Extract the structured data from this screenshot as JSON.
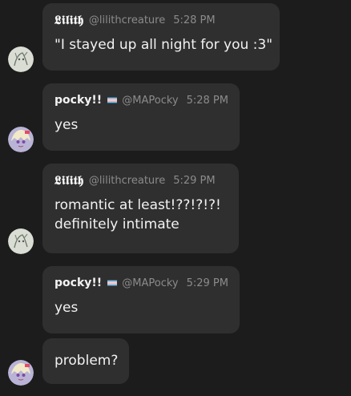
{
  "messages": [
    {
      "author": "𝕷𝖎𝖑𝖎𝖙𝖍",
      "handle": "@lilithcreature",
      "time": "5:28 PM",
      "lines": [
        "\"I stayed up all night for you :3\""
      ]
    },
    {
      "author": "pocky!!",
      "handle": "@MAPocky",
      "time": "5:28 PM",
      "lines": [
        "yes"
      ]
    },
    {
      "author": "𝕷𝖎𝖑𝖎𝖙𝖍",
      "handle": "@lilithcreature",
      "time": "5:29 PM",
      "lines": [
        "romantic at least!??!?!?!",
        "definitely intimate"
      ]
    },
    {
      "author": "pocky!!",
      "handle": "@MAPocky",
      "time": "5:29 PM",
      "lines": [
        "yes"
      ]
    },
    {
      "lines": [
        "problem?"
      ]
    }
  ],
  "colors": {
    "background": "#1c1c1c",
    "bubble": "#2f2f2f",
    "muted_text": "#8b8b8b",
    "flag_blue": "#5bcefa",
    "flag_pink": "#f5a9b8",
    "flag_white": "#ffffff"
  },
  "icons": {
    "lilith_avatar": "sketch-avatar-icon",
    "pocky_avatar": "anime-avatar-icon",
    "pocky_flag": "trans-flag-icon"
  }
}
